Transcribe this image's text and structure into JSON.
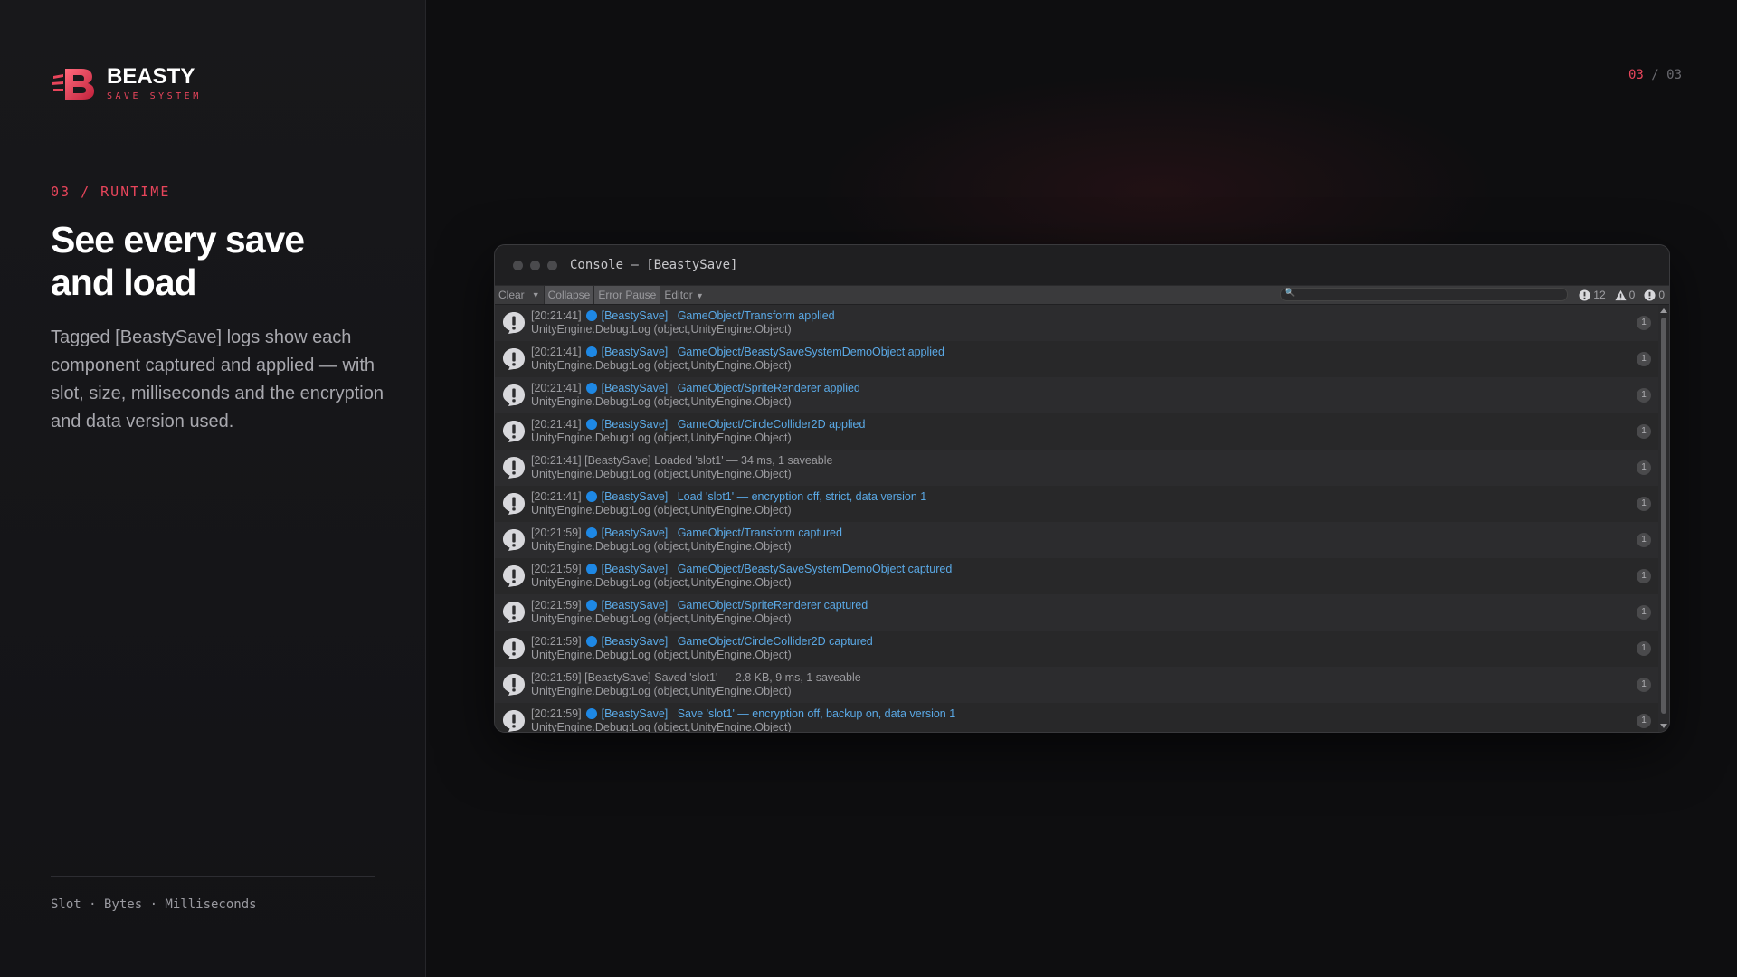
{
  "brand": {
    "name": "BEASTY",
    "subtitle": "SAVE SYSTEM",
    "accent": "#e8455b"
  },
  "section_label": "03 / RUNTIME",
  "headline": "See every save and load",
  "description": "Tagged [BeastySave] logs show each component captured and applied — with slot, size, milliseconds and the encryption and data version used.",
  "footer": "Slot · Bytes · Milliseconds",
  "pagination": {
    "current": "03",
    "separator": " / ",
    "total": "03"
  },
  "console": {
    "title": "Console — [BeastySave]",
    "toolbar": {
      "clear": "Clear",
      "collapse": "Collapse",
      "error_pause": "Error Pause",
      "editor": "Editor"
    },
    "search": {
      "placeholder": ""
    },
    "counters": {
      "info": "12",
      "warnings": "0",
      "errors": "0"
    },
    "logs": [
      {
        "time": "[20:21:41]",
        "bullet": true,
        "tag": "[BeastySave]",
        "message": "GameObject/Transform applied",
        "detail": "UnityEngine.Debug:Log (object,UnityEngine.Object)",
        "count": "1"
      },
      {
        "time": "[20:21:41]",
        "bullet": true,
        "tag": "[BeastySave]",
        "message": "GameObject/BeastySaveSystemDemoObject applied",
        "detail": "UnityEngine.Debug:Log (object,UnityEngine.Object)",
        "count": "1"
      },
      {
        "time": "[20:21:41]",
        "bullet": true,
        "tag": "[BeastySave]",
        "message": "GameObject/SpriteRenderer applied",
        "detail": "UnityEngine.Debug:Log (object,UnityEngine.Object)",
        "count": "1"
      },
      {
        "time": "[20:21:41]",
        "bullet": true,
        "tag": "[BeastySave]",
        "message": "GameObject/CircleCollider2D applied",
        "detail": "UnityEngine.Debug:Log (object,UnityEngine.Object)",
        "count": "1"
      },
      {
        "time": "[20:21:41]",
        "bullet": false,
        "tag": "[BeastySave]",
        "message": "Loaded 'slot1' — 34 ms, 1 saveable",
        "detail": "UnityEngine.Debug:Log (object,UnityEngine.Object)",
        "count": "1"
      },
      {
        "time": "[20:21:41]",
        "bullet": true,
        "tag": "[BeastySave]",
        "message": "Load 'slot1' — encryption off, strict, data version 1",
        "detail": "UnityEngine.Debug:Log (object,UnityEngine.Object)",
        "count": "1"
      },
      {
        "time": "[20:21:59]",
        "bullet": true,
        "tag": "[BeastySave]",
        "message": "GameObject/Transform captured",
        "detail": "UnityEngine.Debug:Log (object,UnityEngine.Object)",
        "count": "1"
      },
      {
        "time": "[20:21:59]",
        "bullet": true,
        "tag": "[BeastySave]",
        "message": "GameObject/BeastySaveSystemDemoObject captured",
        "detail": "UnityEngine.Debug:Log (object,UnityEngine.Object)",
        "count": "1"
      },
      {
        "time": "[20:21:59]",
        "bullet": true,
        "tag": "[BeastySave]",
        "message": "GameObject/SpriteRenderer captured",
        "detail": "UnityEngine.Debug:Log (object,UnityEngine.Object)",
        "count": "1"
      },
      {
        "time": "[20:21:59]",
        "bullet": true,
        "tag": "[BeastySave]",
        "message": "GameObject/CircleCollider2D captured",
        "detail": "UnityEngine.Debug:Log (object,UnityEngine.Object)",
        "count": "1"
      },
      {
        "time": "[20:21:59]",
        "bullet": false,
        "tag": "[BeastySave]",
        "message": "Saved 'slot1' — 2.8 KB, 9 ms, 1 saveable",
        "detail": "UnityEngine.Debug:Log (object,UnityEngine.Object)",
        "count": "1"
      },
      {
        "time": "[20:21:59]",
        "bullet": true,
        "tag": "[BeastySave]",
        "message": "Save 'slot1' — encryption off, backup on, data version 1",
        "detail": "UnityEngine.Debug:Log (object,UnityEngine.Object)",
        "count": "1"
      }
    ]
  }
}
